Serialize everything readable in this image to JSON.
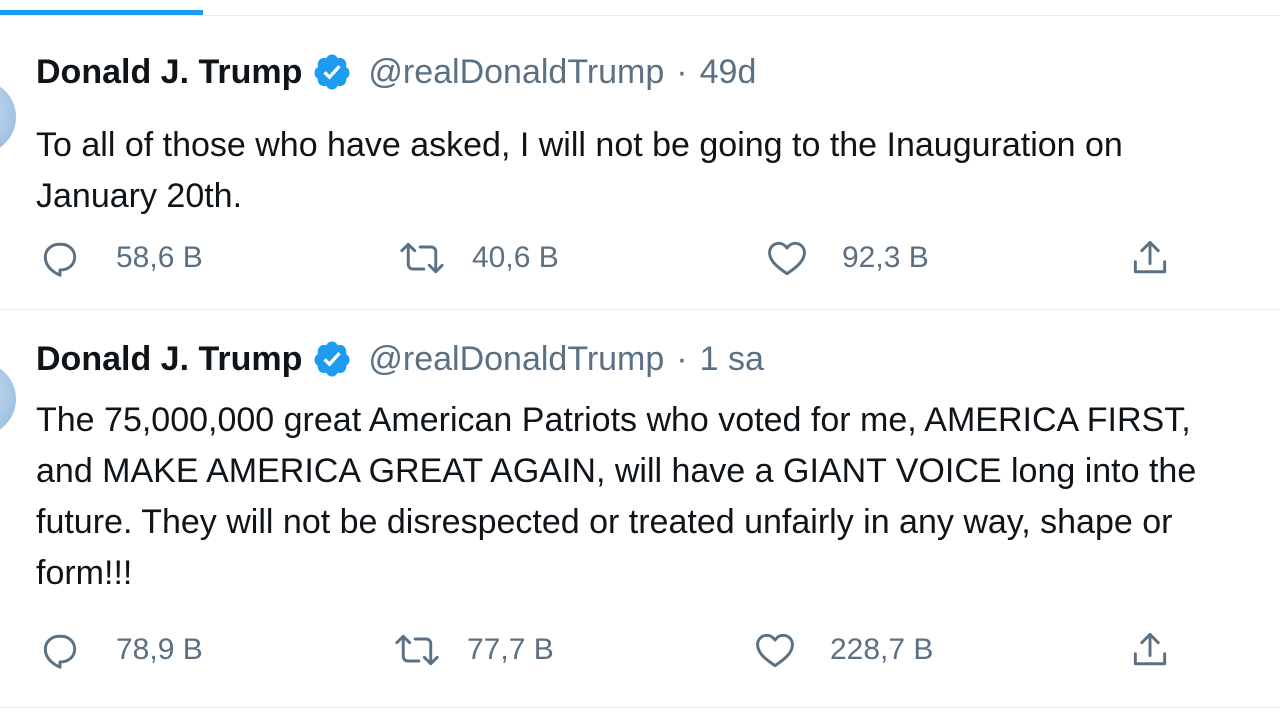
{
  "colors": {
    "accent": "#1d9bf0",
    "text": "#0f1419",
    "secondary": "#5b7083",
    "divider": "#e6ecf0"
  },
  "tweets": [
    {
      "name": "Donald J. Trump",
      "handle": "@realDonaldTrump",
      "separator": "·",
      "time": "49d",
      "text": "To all of those who have asked, I will not be going to the Inauguration on\nJanuary 20th.",
      "replies": "58,6 B",
      "retweets": "40,6 B",
      "likes": "92,3 B"
    },
    {
      "name": "Donald J. Trump",
      "handle": "@realDonaldTrump",
      "separator": "·",
      "time": "1 sa",
      "text": "The 75,000,000 great American Patriots who voted for me, AMERICA FIRST,\nand MAKE AMERICA GREAT AGAIN, will have a GIANT VOICE long into the\nfuture. They will not be disrespected or treated unfairly in any way, shape or\nform!!!",
      "replies": "78,9 B",
      "retweets": "77,7 B",
      "likes": "228,7 B"
    }
  ],
  "icons": {
    "verified": "verified-badge-icon",
    "reply": "reply-icon",
    "retweet": "retweet-icon",
    "like": "heart-icon",
    "share": "share-icon"
  }
}
